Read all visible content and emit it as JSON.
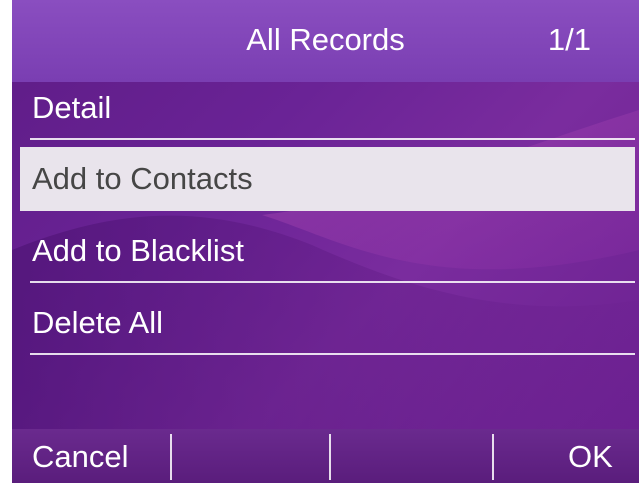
{
  "header": {
    "title": "All Records",
    "page_indicator": "1/1"
  },
  "menu": {
    "items": [
      {
        "label": "Detail",
        "selected": false
      },
      {
        "label": "Add to Contacts",
        "selected": true
      },
      {
        "label": "Add to Blacklist",
        "selected": false
      },
      {
        "label": "Delete All",
        "selected": false
      }
    ]
  },
  "softkeys": {
    "left": "Cancel",
    "middle_left": "",
    "middle_right": "",
    "right": "OK"
  },
  "colors": {
    "background": "#6a2396",
    "title_bar": "#7a3eb2",
    "selection": "#e9e4ec",
    "selected_text": "#464646",
    "text": "#ffffff"
  }
}
